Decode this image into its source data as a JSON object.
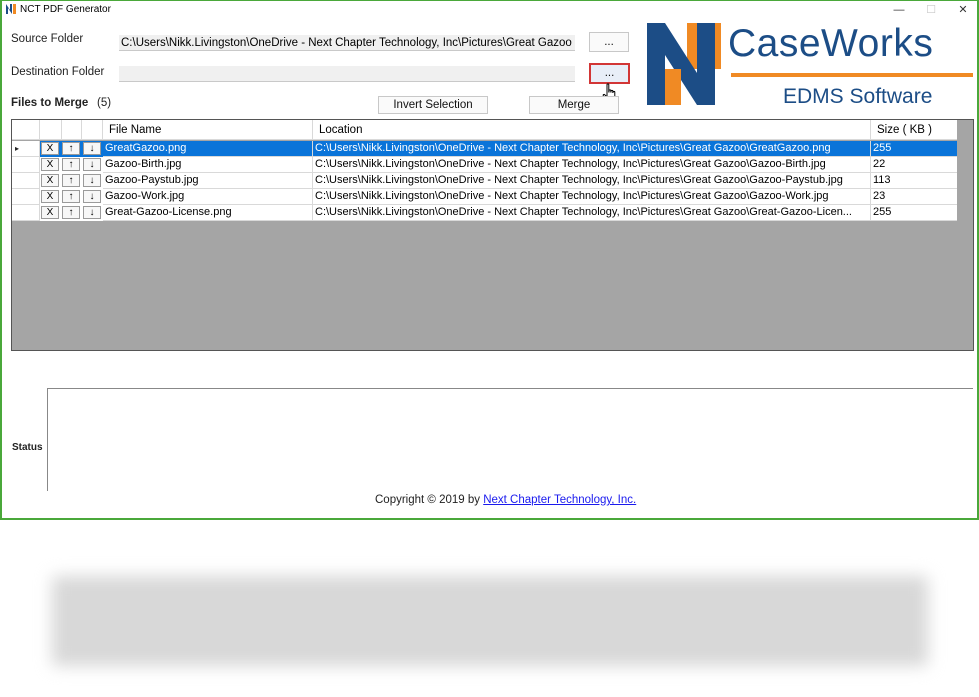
{
  "window": {
    "title": "NCT PDF Generator",
    "minimize": "—",
    "maximize": "☐",
    "close": "✕"
  },
  "form": {
    "source_label": "Source Folder",
    "source_value": "C:\\Users\\Nikk.Livingston\\OneDrive - Next Chapter Technology, Inc\\Pictures\\Great Gazoo",
    "destination_label": "Destination Folder",
    "destination_value": "",
    "browse_label": "...",
    "files_label": "Files to Merge",
    "files_count": "(5)",
    "invert_label": "Invert Selection",
    "merge_label": "Merge"
  },
  "logo": {
    "name": "CaseWorks",
    "tagline": "EDMS Software",
    "brand_blue": "#1c4d86",
    "brand_orange": "#f08a24"
  },
  "grid": {
    "headers": {
      "file_name": "File Name",
      "location": "Location",
      "size": "Size ( KB )"
    },
    "row_selector_icon": "▸",
    "remove_label": "X",
    "up_label": "↑",
    "down_label": "↓",
    "rows": [
      {
        "file": "GreatGazoo.png",
        "location": "C:\\Users\\Nikk.Livingston\\OneDrive - Next Chapter Technology, Inc\\Pictures\\Great Gazoo\\GreatGazoo.png",
        "size": "255"
      },
      {
        "file": "Gazoo-Birth.jpg",
        "location": "C:\\Users\\Nikk.Livingston\\OneDrive - Next Chapter Technology, Inc\\Pictures\\Great Gazoo\\Gazoo-Birth.jpg",
        "size": "22"
      },
      {
        "file": "Gazoo-Paystub.jpg",
        "location": "C:\\Users\\Nikk.Livingston\\OneDrive - Next Chapter Technology, Inc\\Pictures\\Great Gazoo\\Gazoo-Paystub.jpg",
        "size": "113"
      },
      {
        "file": "Gazoo-Work.jpg",
        "location": "C:\\Users\\Nikk.Livingston\\OneDrive - Next Chapter Technology, Inc\\Pictures\\Great Gazoo\\Gazoo-Work.jpg",
        "size": "23"
      },
      {
        "file": "Great-Gazoo-License.png",
        "location": "C:\\Users\\Nikk.Livingston\\OneDrive - Next Chapter Technology, Inc\\Pictures\\Great Gazoo\\Great-Gazoo-Licen...",
        "size": "255"
      }
    ],
    "selected_color": "#0a74d9"
  },
  "status": {
    "label": "Status",
    "text": ""
  },
  "footer": {
    "prefix": "Copyright © 2019 by ",
    "link": "Next Chapter Technology, Inc."
  }
}
